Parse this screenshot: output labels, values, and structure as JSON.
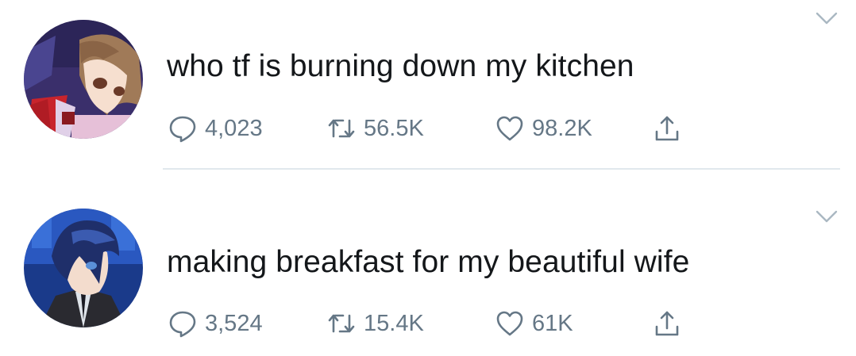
{
  "tweets": [
    {
      "text": "who tf is burning down my kitchen",
      "replies": "4,023",
      "retweets": "56.5K",
      "likes": "98.2K",
      "avatar_icon": "avatar-girl-brown-hair"
    },
    {
      "text": "making breakfast for my beautiful wife",
      "replies": "3,524",
      "retweets": "15.4K",
      "likes": "61K",
      "avatar_icon": "avatar-boy-blue-hair"
    }
  ],
  "icons": {
    "reply": "speech-bubble-icon",
    "retweet": "retweet-arrows-icon",
    "like": "heart-icon",
    "share": "share-upload-icon",
    "menu": "chevron-down-icon"
  },
  "colors": {
    "text": "#14171a",
    "secondary": "#657786",
    "divider": "#e1e8ed",
    "chevron": "#aab8c2"
  }
}
